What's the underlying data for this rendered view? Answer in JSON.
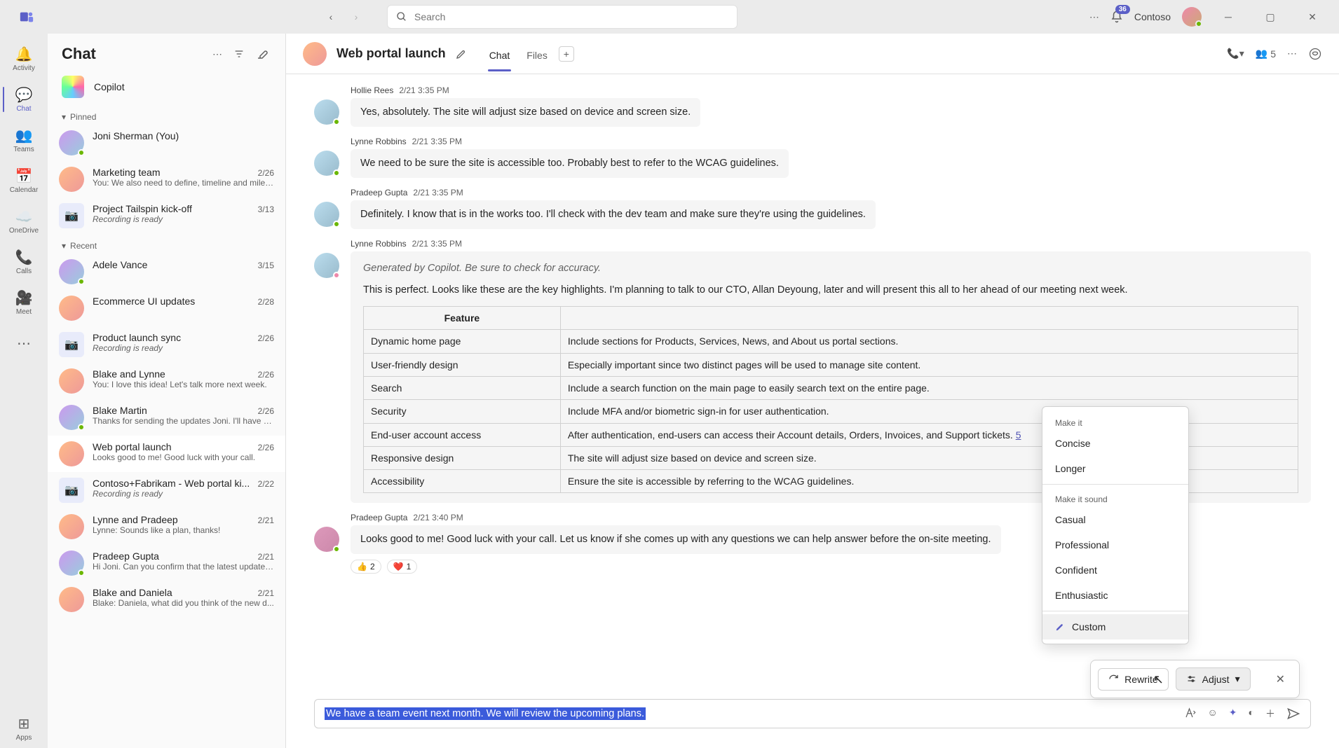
{
  "titlebar": {
    "search_placeholder": "Search",
    "notif_count": "36",
    "org": "Contoso"
  },
  "rail": {
    "items": [
      {
        "label": "Activity",
        "key": "activity"
      },
      {
        "label": "Chat",
        "key": "chat"
      },
      {
        "label": "Teams",
        "key": "teams"
      },
      {
        "label": "Calendar",
        "key": "calendar"
      },
      {
        "label": "OneDrive",
        "key": "onedrive"
      },
      {
        "label": "Calls",
        "key": "calls"
      },
      {
        "label": "Meet",
        "key": "meet"
      }
    ],
    "apps_label": "Apps"
  },
  "chatlist": {
    "title": "Chat",
    "copilot": "Copilot",
    "pinned_label": "Pinned",
    "recent_label": "Recent",
    "pinned": [
      {
        "name": "Joni Sherman (You)",
        "sub": "",
        "date": "",
        "type": "person"
      },
      {
        "name": "Marketing team",
        "sub": "You: We also need to define, timeline and miles...",
        "date": "2/26",
        "type": "group"
      },
      {
        "name": "Project Tailspin kick-off",
        "sub": "Recording is ready",
        "date": "3/13",
        "type": "meeting",
        "ital": true
      }
    ],
    "recent": [
      {
        "name": "Adele Vance",
        "sub": "",
        "date": "3/15",
        "type": "person"
      },
      {
        "name": "Ecommerce UI updates",
        "sub": "",
        "date": "2/28",
        "type": "group"
      },
      {
        "name": "Product launch sync",
        "sub": "Recording is ready",
        "date": "2/26",
        "type": "meeting",
        "ital": true
      },
      {
        "name": "Blake and Lynne",
        "sub": "You: I love this idea! Let's talk more next week.",
        "date": "2/26",
        "type": "group"
      },
      {
        "name": "Blake Martin",
        "sub": "Thanks for sending the updates Joni. I'll have s...",
        "date": "2/26",
        "type": "person"
      },
      {
        "name": "Web portal launch",
        "sub": "Looks good to me! Good luck with your call.",
        "date": "2/26",
        "type": "group",
        "selected": true
      },
      {
        "name": "Contoso+Fabrikam - Web portal ki...",
        "sub": "Recording is ready",
        "date": "2/22",
        "type": "meeting",
        "ital": true
      },
      {
        "name": "Lynne and Pradeep",
        "sub": "Lynne: Sounds like a plan, thanks!",
        "date": "2/21",
        "type": "group"
      },
      {
        "name": "Pradeep Gupta",
        "sub": "Hi Joni. Can you confirm that the latest updates...",
        "date": "2/21",
        "type": "person"
      },
      {
        "name": "Blake and Daniela",
        "sub": "Blake: Daniela, what did you think of the new d...",
        "date": "2/21",
        "type": "group"
      }
    ]
  },
  "convo": {
    "title": "Web portal launch",
    "tabs": [
      "Chat",
      "Files"
    ],
    "people_count": "5",
    "messages": [
      {
        "author": "Hollie Rees",
        "time": "2/21 3:35 PM",
        "text": "Yes, absolutely. The site will adjust size based on device and screen size."
      },
      {
        "author": "Lynne Robbins",
        "time": "2/21 3:35 PM",
        "text": "We need to be sure the site is accessible too. Probably best to refer to the WCAG guidelines."
      },
      {
        "author": "Pradeep Gupta",
        "time": "2/21 3:35 PM",
        "text": "Definitely. I know that is in the works too. I'll check with the dev team and make sure they're using the guidelines."
      }
    ],
    "copilot_msg": {
      "author": "Lynne Robbins",
      "time": "2/21 3:35 PM",
      "note": "Generated by Copilot. Be sure to check for accuracy.",
      "body": "This is perfect. Looks like these are the key highlights. I'm planning to talk to our CTO, Allan Deyoung, later and will present this all to her ahead of our meeting next week.",
      "table_header": "Feature",
      "rows": [
        {
          "f": "Dynamic home page",
          "d": "Include sections for Products, Services, News, and About us portal sections."
        },
        {
          "f": "User-friendly design",
          "d": "Especially important since two distinct pages will be used to manage site content."
        },
        {
          "f": "Search",
          "d": "Include a search function on the main page to easily search text on the entire page."
        },
        {
          "f": "Security",
          "d": "Include MFA and/or biometric sign-in for user authentication."
        },
        {
          "f": "End-user account access",
          "d": "After authentication, end-users can access their Account details, Orders, Invoices, and Support tickets.",
          "link": "5"
        },
        {
          "f": "Responsive design",
          "d": "The site will adjust size based on device and screen size."
        },
        {
          "f": "Accessibility",
          "d": "Ensure the site is accessible by referring to the WCAG guidelines."
        }
      ]
    },
    "last_msg": {
      "author": "Pradeep Gupta",
      "time": "2/21 3:40 PM",
      "text": "Looks good to me! Good luck with your call. Let us know if she comes up with any questions we can help answer before the on-site meeting.",
      "reactions": [
        {
          "e": "👍",
          "c": "2"
        },
        {
          "e": "❤️",
          "c": "1"
        }
      ]
    }
  },
  "copilot_bar": {
    "rewrite": "Rewrite",
    "adjust": "Adjust"
  },
  "adjust_menu": {
    "label1": "Make it",
    "opts1": [
      "Concise",
      "Longer"
    ],
    "label2": "Make it sound",
    "opts2": [
      "Casual",
      "Professional",
      "Confident",
      "Enthusiastic"
    ],
    "custom": "Custom"
  },
  "compose": {
    "text": "We have a team event next month. We will review the upcoming plans."
  }
}
